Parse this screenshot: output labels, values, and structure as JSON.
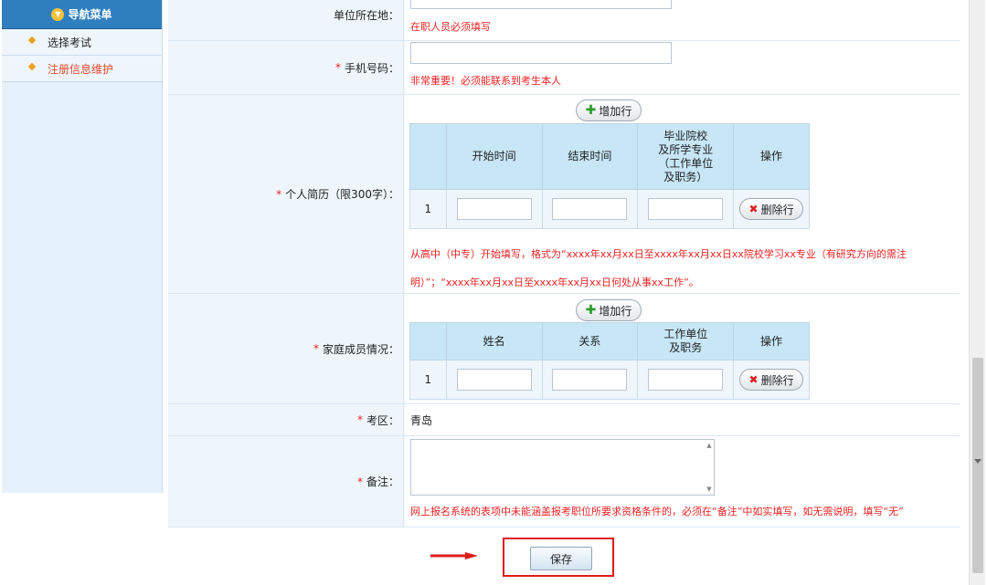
{
  "sidebar": {
    "header": "导航菜单",
    "items": [
      {
        "label": "选择考试"
      },
      {
        "label": "注册信息维护"
      }
    ]
  },
  "form": {
    "unit_location": {
      "label": "单位所在地：",
      "hint": "在职人员必须填写"
    },
    "phone": {
      "star": "*",
      "label": "手机号码：",
      "hint": "非常重要！必须能联系到考生本人"
    },
    "resume": {
      "star": "*",
      "label": "个人简历（限300字）：",
      "add_button": "增加行",
      "columns": [
        "",
        "开始时间",
        "结束时间",
        "毕业院校\n及所学专业\n（工作单位\n及职务）",
        "操作"
      ],
      "rows": [
        {
          "index": "1",
          "delete_button": "删除行"
        }
      ],
      "hint_line1": "从高中（中专）开始填写，格式为“xxxx年xx月xx日至xxxx年xx月xx日xx院校学习xx专业（有研究方向的需注",
      "hint_line2": "明）”；“xxxx年xx月xx日至xxxx年xx月xx日何处从事xx工作”。"
    },
    "family": {
      "star": "*",
      "label": "家庭成员情况：",
      "add_button": "增加行",
      "columns": [
        "",
        "姓名",
        "关系",
        "工作单位\n及职务",
        "操作"
      ],
      "rows": [
        {
          "index": "1",
          "delete_button": "删除行"
        }
      ]
    },
    "exam_area": {
      "star": "*",
      "label": "考区：",
      "value": "青岛"
    },
    "remark": {
      "star": "*",
      "label": "备注：",
      "hint": "网上报名系统的表项中未能涵盖报考职位所要求资格条件的，必须在“备注”中如实填写，如无需说明，填写“无”"
    }
  },
  "save_button": "保存",
  "colors": {
    "accent": "#2f7fbf",
    "hint": "#ee2222",
    "header_cell": "#c7e6f6",
    "highlight_box": "#e01b1b"
  }
}
